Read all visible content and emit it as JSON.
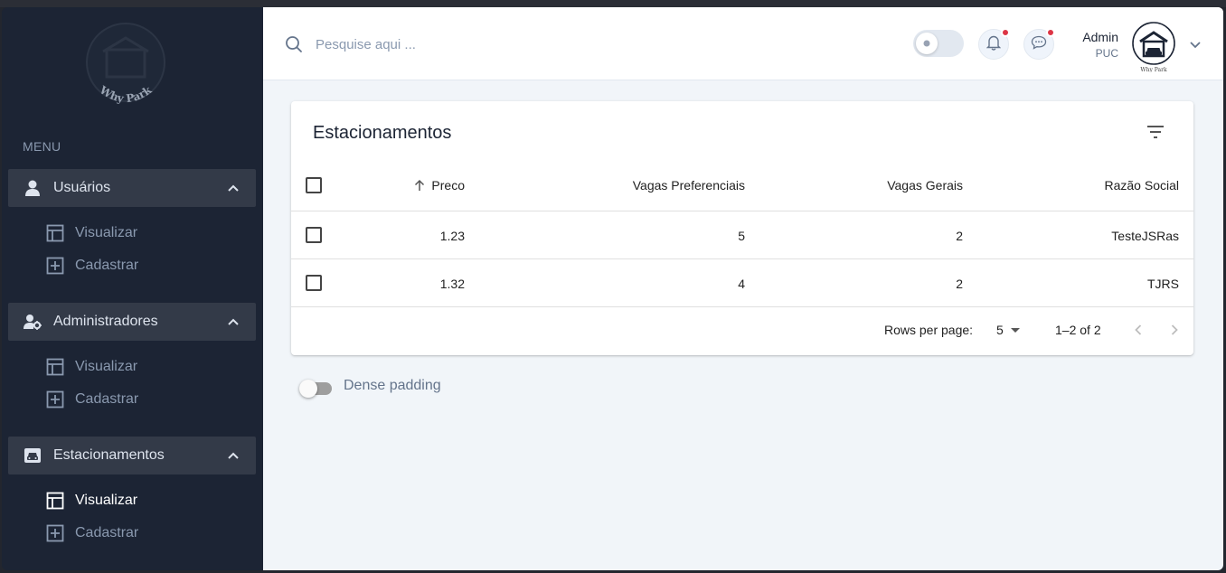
{
  "sidebar": {
    "logo_text": "Why Park",
    "menu_label": "MENU",
    "groups": [
      {
        "label": "Usuários",
        "icon": "user-icon",
        "items": [
          {
            "label": "Visualizar",
            "icon": "table-icon"
          },
          {
            "label": "Cadastrar",
            "icon": "plus-square-icon"
          }
        ]
      },
      {
        "label": "Administradores",
        "icon": "user-gear-icon",
        "items": [
          {
            "label": "Visualizar",
            "icon": "table-icon"
          },
          {
            "label": "Cadastrar",
            "icon": "plus-square-icon"
          }
        ]
      },
      {
        "label": "Estacionamentos",
        "icon": "car-icon",
        "items": [
          {
            "label": "Visualizar",
            "icon": "table-icon",
            "active": true
          },
          {
            "label": "Cadastrar",
            "icon": "plus-square-icon"
          }
        ]
      }
    ]
  },
  "header": {
    "search_placeholder": "Pesquise aqui ...",
    "user_name": "Admin",
    "user_role": "PUC"
  },
  "table": {
    "title": "Estacionamentos",
    "columns": [
      "Preco",
      "Vagas Preferenciais",
      "Vagas Gerais",
      "Razão Social"
    ],
    "sorted_column": "Preco",
    "sort_direction": "asc",
    "rows": [
      [
        "1.23",
        "5",
        "2",
        "TesteJSRas"
      ],
      [
        "1.32",
        "4",
        "2",
        "TJRS"
      ]
    ],
    "rows_per_page_label": "Rows per page:",
    "rows_per_page": "5",
    "range": "1–2 of 2"
  },
  "dense_padding_label": "Dense padding",
  "colors": {
    "sidebar_bg": "#1c2434",
    "group_head_bg": "#333a48",
    "main_bg": "#f1f5f9",
    "notification_dot": "#dc3545"
  }
}
